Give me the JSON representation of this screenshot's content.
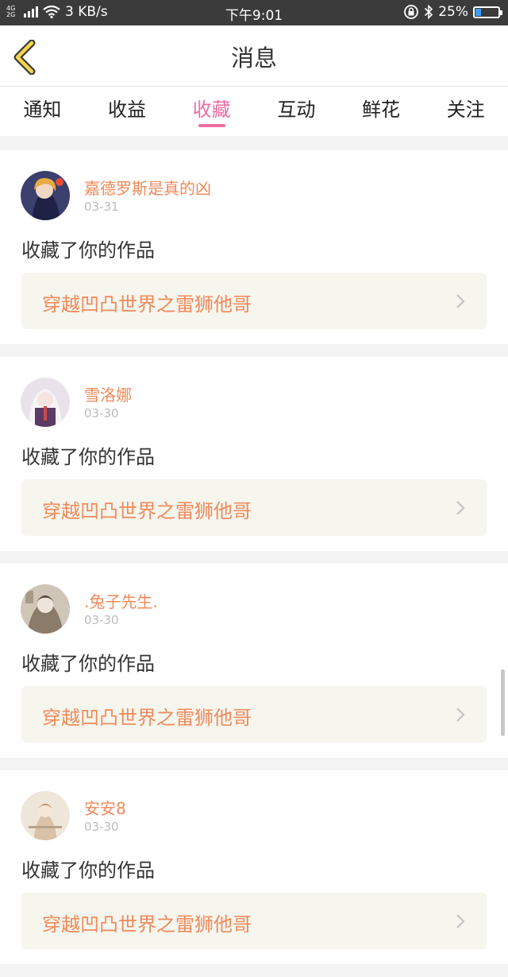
{
  "status_bar": {
    "network": "4G\n2G",
    "speed": "3 KB/s",
    "time": "下午9:01",
    "battery_text": "25%",
    "battery_level": 0.25
  },
  "header": {
    "title": "消息"
  },
  "tabs": [
    {
      "label": "通知",
      "active": false
    },
    {
      "label": "收益",
      "active": false
    },
    {
      "label": "收藏",
      "active": true
    },
    {
      "label": "互动",
      "active": false
    },
    {
      "label": "鲜花",
      "active": false
    },
    {
      "label": "关注",
      "active": false
    }
  ],
  "colors": {
    "accent": "#ec6ea3",
    "username": "#f08a5a",
    "work_bg": "#f6f5ee"
  },
  "feed": [
    {
      "user": "嘉德罗斯是真的凶",
      "date": "03-31",
      "action": "收藏了你的作品",
      "work": "穿越凹凸世界之雷狮他哥"
    },
    {
      "user": "雪洛娜",
      "date": "03-30",
      "action": "收藏了你的作品",
      "work": "穿越凹凸世界之雷狮他哥"
    },
    {
      "user": ".兔子先生.",
      "date": "03-30",
      "action": "收藏了你的作品",
      "work": "穿越凹凸世界之雷狮他哥"
    },
    {
      "user": "安安8",
      "date": "03-30",
      "action": "收藏了你的作品",
      "work": "穿越凹凸世界之雷狮他哥"
    }
  ]
}
